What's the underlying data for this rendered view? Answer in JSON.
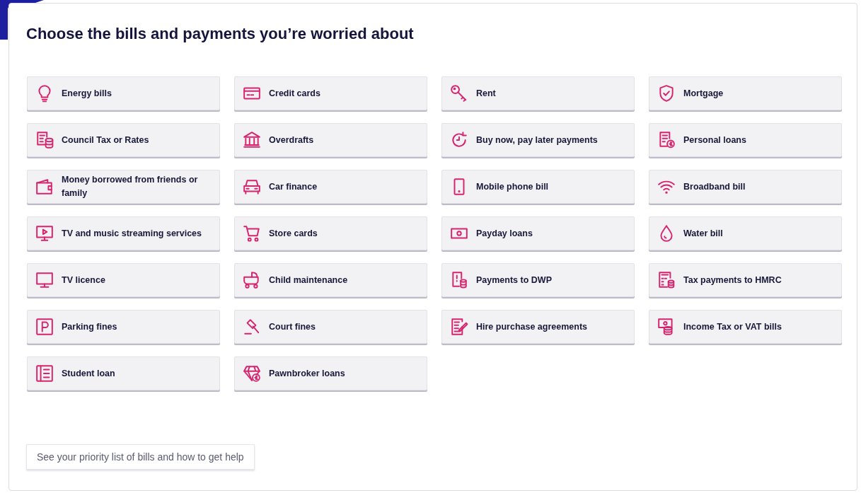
{
  "heading": "Choose the bills and payments you’re worried about",
  "options": [
    {
      "label": "Energy bills"
    },
    {
      "label": "Credit cards"
    },
    {
      "label": "Rent"
    },
    {
      "label": "Mortgage"
    },
    {
      "label": "Council Tax or Rates"
    },
    {
      "label": "Overdrafts"
    },
    {
      "label": "Buy now, pay later payments"
    },
    {
      "label": "Personal loans"
    },
    {
      "label": "Money borrowed from friends or family"
    },
    {
      "label": "Car finance"
    },
    {
      "label": "Mobile phone bill"
    },
    {
      "label": "Broadband bill"
    },
    {
      "label": "TV and music streaming services"
    },
    {
      "label": "Store cards"
    },
    {
      "label": "Payday loans"
    },
    {
      "label": "Water bill"
    },
    {
      "label": "TV licence"
    },
    {
      "label": "Child maintenance"
    },
    {
      "label": "Payments to DWP"
    },
    {
      "label": "Tax payments to HMRC"
    },
    {
      "label": "Parking fines"
    },
    {
      "label": "Court fines"
    },
    {
      "label": "Hire purchase agreements"
    },
    {
      "label": "Income Tax or VAT bills"
    },
    {
      "label": "Student loan"
    },
    {
      "label": "Pawnbroker loans"
    }
  ],
  "help_button": "See your priority list of bills and how to get help"
}
